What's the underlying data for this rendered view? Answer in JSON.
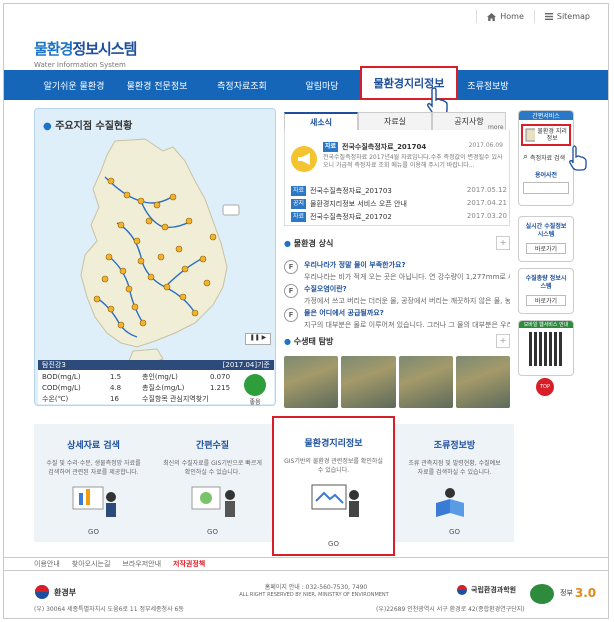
{
  "header": {
    "home_label": "Home",
    "sitemap_label": "Sitemap",
    "logo_main_a": "물환경",
    "logo_main_b": "정보시스템",
    "logo_sub": "Water Information System"
  },
  "nav": {
    "items": [
      "알기쉬운 물환경",
      "물환경 전문정보",
      "측정자료조회",
      "알림마당",
      "물환경지리정보",
      "조류정보방"
    ]
  },
  "map_panel": {
    "title": "주요지점 수질현황",
    "station": "탐진강3",
    "date_label": "[2017.04]기준",
    "rows": [
      {
        "k1": "BOD(mg/L)",
        "v1": "1.5",
        "k2": "총인(mg/L)",
        "v2": "0.070"
      },
      {
        "k1": "COD(mg/L)",
        "v1": "4.8",
        "k2": "총질소(mg/L)",
        "v2": "1.215"
      },
      {
        "k1": "수온(℃)",
        "v1": "16",
        "k2": "수질항목 관심지역찾기",
        "v2": ""
      }
    ],
    "weather_label": "좋음"
  },
  "news": {
    "tabs": [
      "새소식",
      "자료실",
      "공지사항"
    ],
    "more": "more",
    "featured_tag": "자료",
    "featured_title": "전국수질측정자료_201704",
    "featured_date": "2017.06.09",
    "featured_desc": "전국수질측정자료 2017년4월 자료입니다.수추 측정값이 변경될수 있사오니 가급적 측정자료 조회 메뉴를 이용해 주시기 바랍니다...",
    "items": [
      {
        "tag": "자료",
        "text": "전국수질측정자료_201703",
        "date": "2017.05.12"
      },
      {
        "tag": "공지",
        "text": "물환경지리정보 서비스 오픈 안내",
        "date": "2017.04.21"
      },
      {
        "tag": "자료",
        "text": "전국수질측정자료_201702",
        "date": "2017.03.20"
      }
    ]
  },
  "knowledge": {
    "title": "물환경 상식",
    "items": [
      {
        "q": "우리나라가 정말 물이 부족한가요?",
        "a": "우리나라는 비가 적게 오는 곳은 아닙니다. 연 강수량이 1,277mm로 세계..."
      },
      {
        "q": "수질오염이란?",
        "a": "가정에서 쓰고 버리는 더러운 물, 공장에서 버리는 깨끗하지 않은 물, 농촌의 가..."
      },
      {
        "q": "물은 어디에서 공급될까요?",
        "a": "지구의 대부분은 물로 이루어져 있습니다. 그러나 그 물의 대부분은 우리가..."
      }
    ]
  },
  "ecology": {
    "title": "수생태 탐방"
  },
  "right": {
    "top_label": "간편서비스",
    "geo_label": "물환경 지리정보",
    "measure_label": "측정자료 검색",
    "dict_label": "용어사전",
    "realtime_title": "실시간 수질정보시스템",
    "realtime_btn": "바로가기",
    "total_title": "수질총량 정보시스템",
    "total_btn": "바로가기",
    "mobile_label": "모바일 웹서비스 안내",
    "top_btn": "TOP"
  },
  "panels": [
    {
      "title": "상세자료 검색",
      "desc": "수질 및 수리·수문, 생물측정망 자료를 검색하여 관련된 자료를 제공합니다.",
      "go": "GO"
    },
    {
      "title": "간편수질",
      "desc": "최신의 수질자료를 GIS기반으로 빠르게 확인하실 수 있습니다.",
      "go": "GO"
    },
    {
      "title": "물환경지리정보",
      "desc": "GIS기반의 물환경 관련정보를 확인하실 수 있습니다.",
      "go": "GO"
    },
    {
      "title": "조류정보방",
      "desc": "조류 관측지점 및 발령현황, 수질예보 자료를 검색하실 수 있습니다.",
      "go": "GO"
    }
  ],
  "footer": {
    "nav": [
      "이용안내",
      "찾아오시는길",
      "브라우저안내",
      "저작권정책"
    ],
    "ministry": "환경부",
    "ministry_addr": "(우) 30064 세종특별자치시 도움6로 11 정부세종청사 6동",
    "contact": "홈페이지 안내 : 032-560-7530, 7490",
    "rights": "ALL RIGHT RESERVED BY NIER, MINISTRY OF ENVIRONMENT",
    "institute": "국립환경과학원",
    "institute_addr": "(우)22689 인천광역시 서구 환경로 42(종합환경연구단지)",
    "gov_label": "정부"
  },
  "colors": {
    "nav": "#1565b8",
    "accent": "#1d4f9c",
    "highlight": "#d81e27"
  }
}
